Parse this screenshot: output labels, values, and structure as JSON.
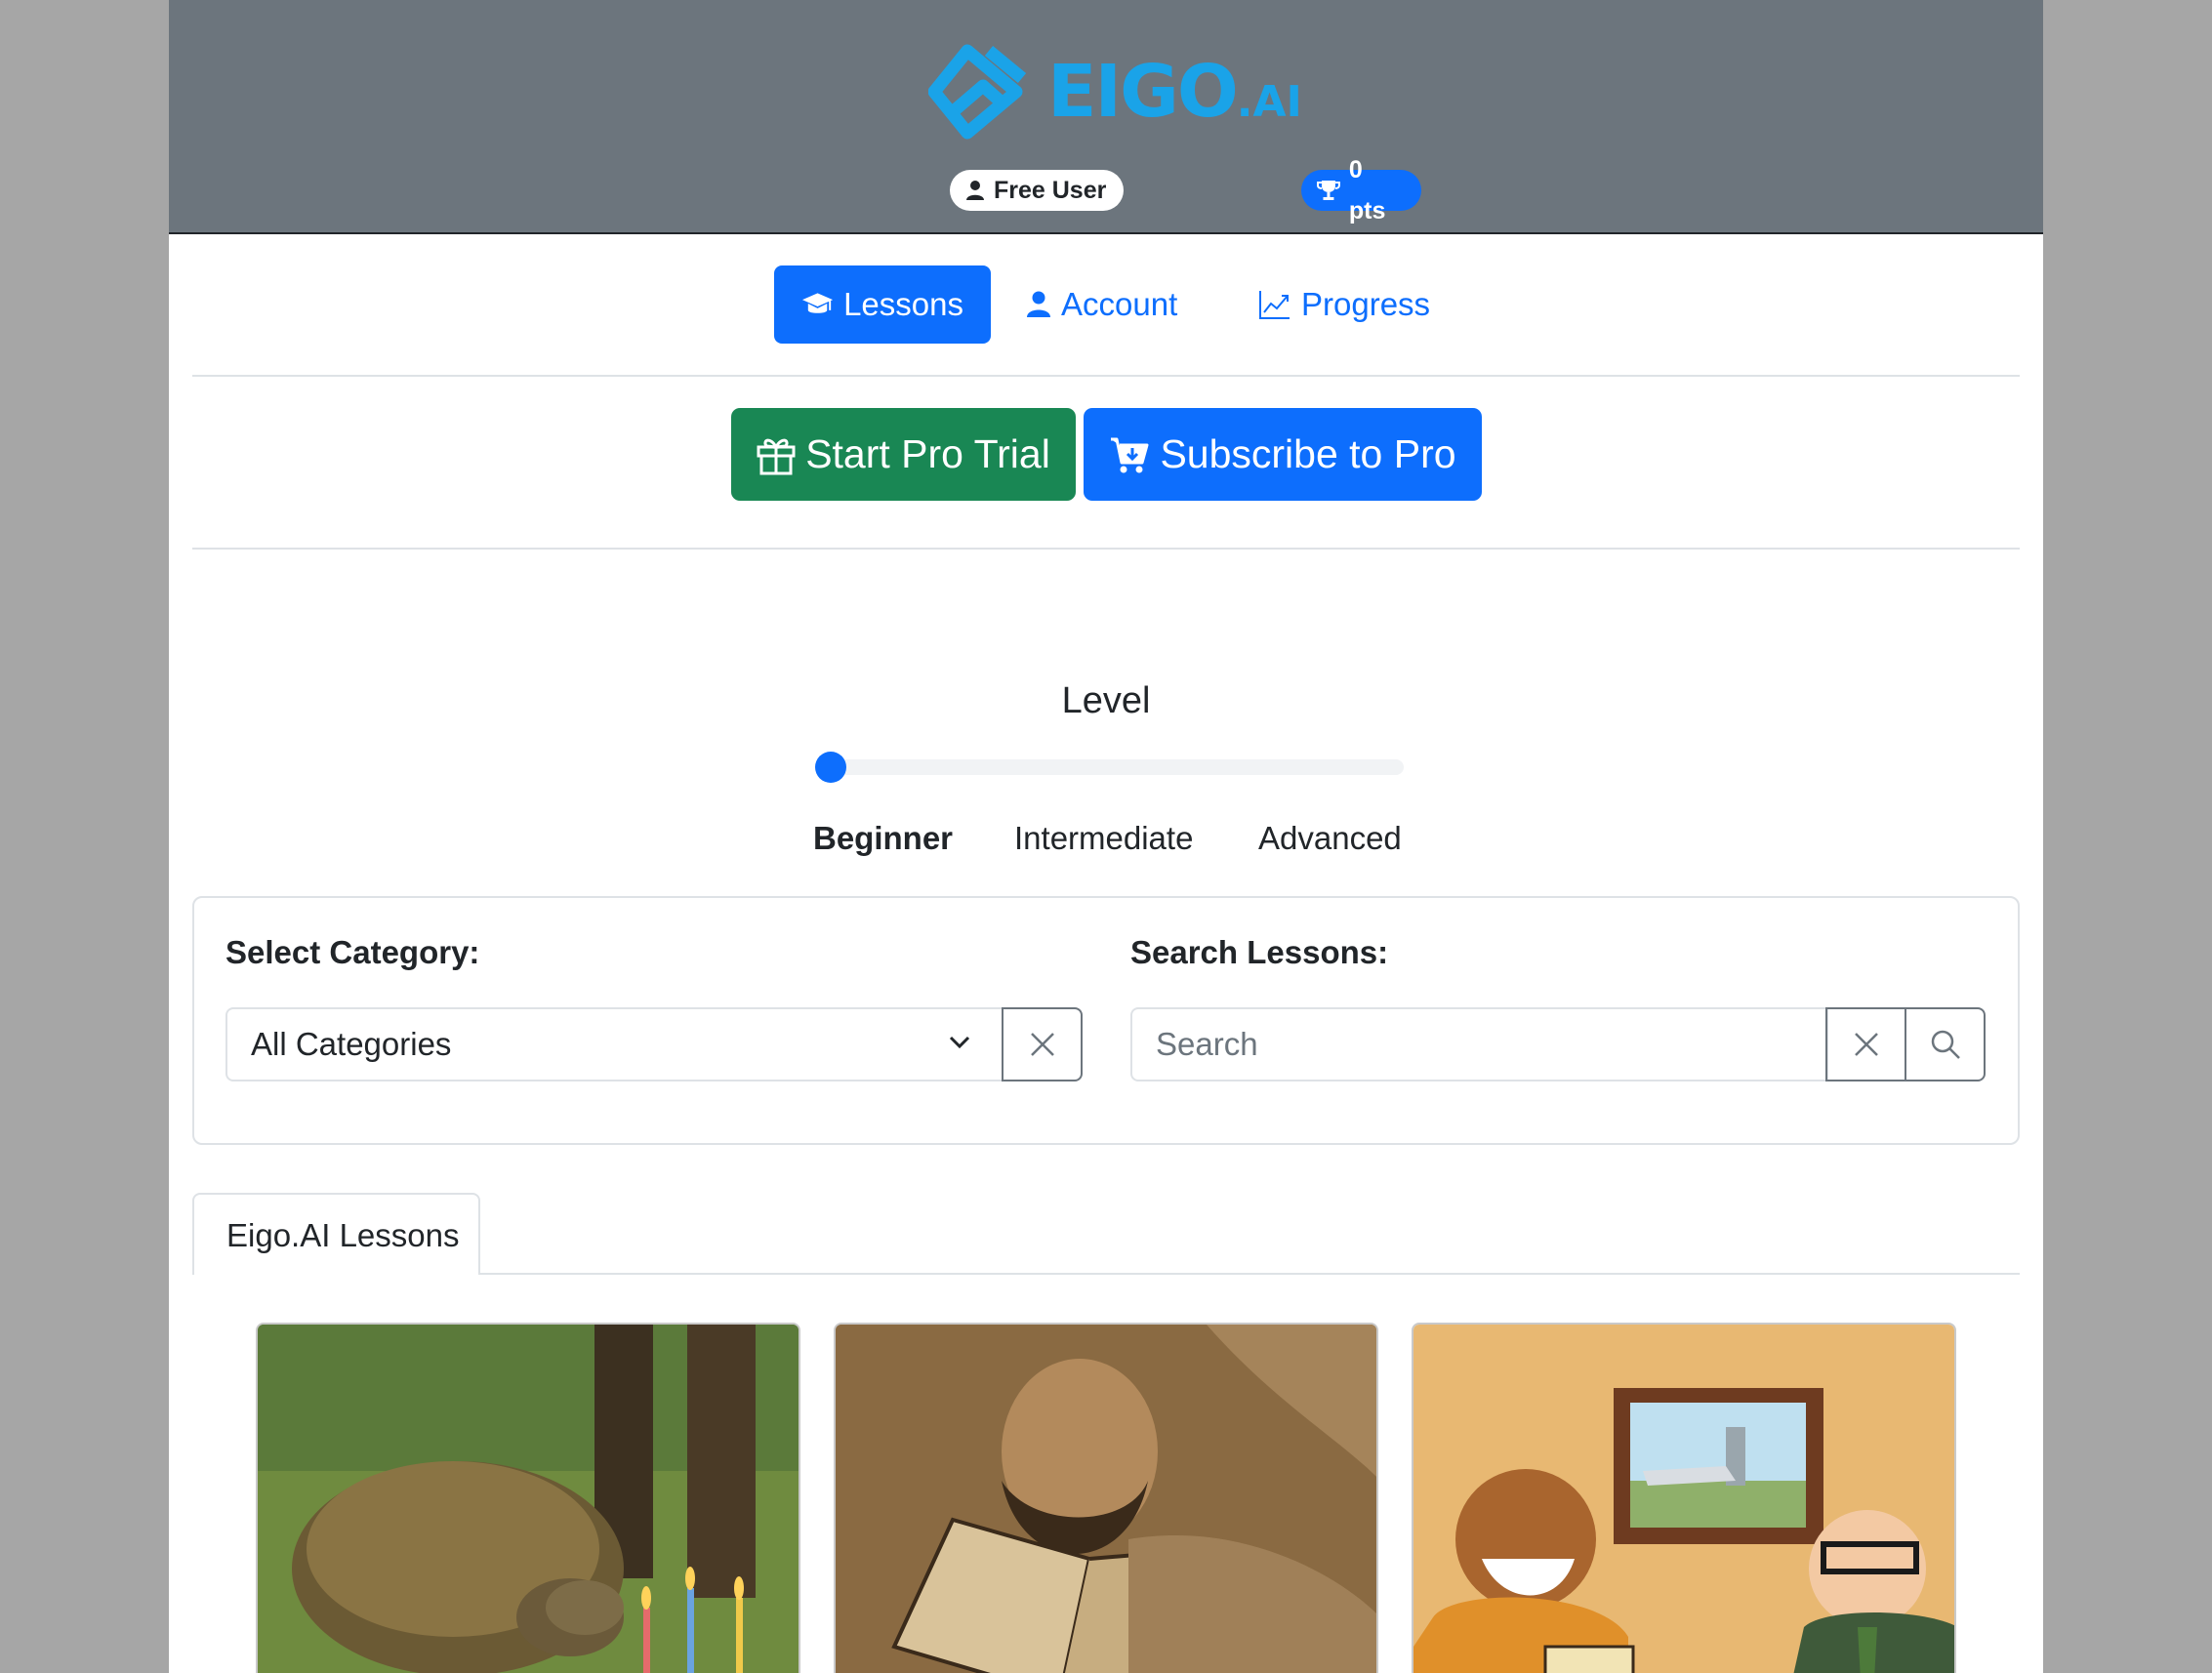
{
  "header": {
    "logo_text": "EIGO",
    "logo_suffix": ".AI",
    "user_badge": "Free User",
    "points_badge": "0 pts"
  },
  "nav": {
    "lessons": "Lessons",
    "account": "Account",
    "progress": "Progress"
  },
  "cta": {
    "trial": "Start Pro Trial",
    "subscribe": "Subscribe to Pro"
  },
  "level": {
    "title": "Level",
    "options": [
      "Beginner",
      "Intermediate",
      "Advanced"
    ],
    "selected": "Beginner",
    "slider_value": 0
  },
  "filters": {
    "category_label": "Select Category:",
    "category_value": "All Categories",
    "search_label": "Search Lessons:",
    "search_placeholder": "Search"
  },
  "tabs": [
    {
      "label": "Eigo.AI Lessons",
      "active": true
    }
  ],
  "lessons": [
    {
      "image": "tortoise-birthday-cake-photo"
    },
    {
      "image": "tired-man-reading-book-illustration"
    },
    {
      "image": "airport-laughing-men-illustration"
    }
  ],
  "colors": {
    "primary": "#0d6efd",
    "success": "#198754",
    "header_bg": "#6c757d",
    "logo": "#1aa3e8"
  }
}
